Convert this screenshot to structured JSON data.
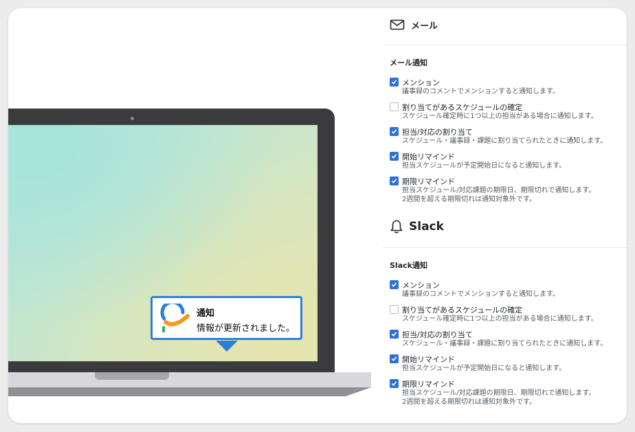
{
  "email": {
    "header_label": "メール",
    "icon": "envelope-icon",
    "group_title": "メール通知",
    "options": [
      {
        "label": "メンション",
        "desc": "議事録のコメントでメンションすると通知します。",
        "checked": true
      },
      {
        "label": "割り当てがあるスケジュールの確定",
        "desc": "スケジュール確定時に1つ以上の担当がある場合に通知します。",
        "checked": false
      },
      {
        "label": "担当/対応の割り当て",
        "desc": "スケジュール・議事録・課題に割り当てられたときに通知します。",
        "checked": true
      },
      {
        "label": "開始リマインド",
        "desc": "担当スケジュールが予定開始日になると通知します。",
        "checked": true
      },
      {
        "label": "期限リマインド",
        "desc": "担当スケジュール/対応課題の期限日、期限切れで通知します。",
        "desc2": "2週間を超える期限切れは通知対象外です。",
        "checked": true
      }
    ]
  },
  "slack": {
    "header_label": "Slack",
    "icon": "bell-icon",
    "group_title": "Slack通知",
    "options": [
      {
        "label": "メンション",
        "desc": "議事録のコメントでメンションすると通知します。",
        "checked": true
      },
      {
        "label": "割り当てがあるスケジュールの確定",
        "desc": "スケジュール確定時に1つ以上の担当がある場合に通知します。",
        "checked": false
      },
      {
        "label": "担当/対応の割り当て",
        "desc": "スケジュール・議事録・課題に割り当てられたときに通知します。",
        "checked": true
      },
      {
        "label": "開始リマインド",
        "desc": "担当スケジュールが予定開始日になると通知します。",
        "checked": true
      },
      {
        "label": "期限リマインド",
        "desc": "担当スケジュール/対応課題の期限日、期限切れで通知します。",
        "desc2": "2週間を超える期限切れは通知対象外です。",
        "checked": true
      }
    ]
  },
  "toast": {
    "title": "通知",
    "body": "情報が更新されました。",
    "logo_icon": "app-logo-icon"
  },
  "colors": {
    "accent": "#2f6fd6",
    "toast_border": "#2f7fda",
    "logo_blue": "#2d7fd7",
    "logo_orange": "#f39a1c",
    "logo_green": "#3aaa5c"
  }
}
